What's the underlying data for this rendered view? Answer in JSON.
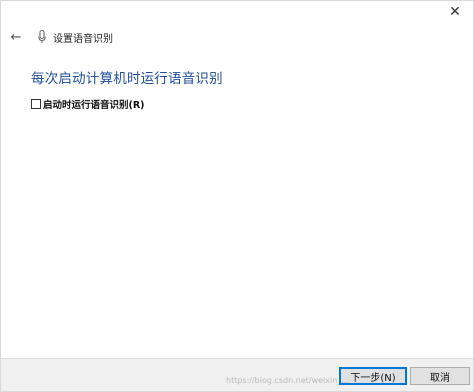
{
  "window": {
    "close_glyph": "✕"
  },
  "header": {
    "back_glyph": "←",
    "title": "设置语音识别"
  },
  "main": {
    "heading": "每次启动计算机时运行语音识别",
    "checkbox_label": "启动时运行语音识别(R)",
    "checkbox_checked": false
  },
  "footer": {
    "next_label": "下一步(N)",
    "cancel_label": "取消",
    "watermark": "https://blog.csdn.net/weixin_..."
  },
  "colors": {
    "heading": "#1f4e9a",
    "footer_bg": "#f0f0f0",
    "focus_border": "#0078d7"
  }
}
